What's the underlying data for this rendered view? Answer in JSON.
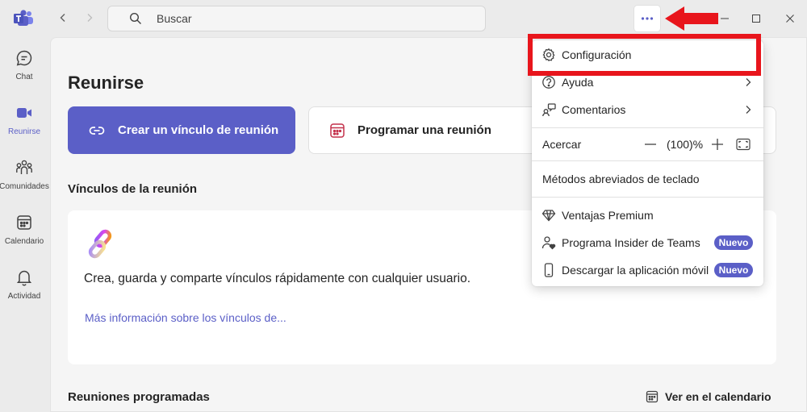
{
  "rail": {
    "items": [
      {
        "label": "Chat"
      },
      {
        "label": "Reunirse"
      },
      {
        "label": "Comunidades"
      },
      {
        "label": "Calendario"
      },
      {
        "label": "Actividad"
      }
    ]
  },
  "titlebar": {
    "search_placeholder": "Buscar"
  },
  "main": {
    "title": "Reunirse",
    "create_link_label": "Crear un vínculo de reunión",
    "schedule_label": "Programar una reunión",
    "links_section_title": "Vínculos de la reunión",
    "card_text": "Crea, guarda y comparte vínculos rápidamente con cualquier usuario.",
    "card_link": "Más información sobre los vínculos de...",
    "scheduled_title": "Reuniones programadas",
    "calendar_link": "Ver en el calendario"
  },
  "menu": {
    "settings": "Configuración",
    "help": "Ayuda",
    "feedback": "Comentarios",
    "zoom_label": "Acercar",
    "zoom_value": "(100)%",
    "shortcuts": "Métodos abreviados de teclado",
    "premium": "Ventajas Premium",
    "insider": "Programa Insider de Teams",
    "insider_badge": "Nuevo",
    "mobile": "Descargar la aplicación móvil",
    "mobile_badge": "Nuevo"
  },
  "colors": {
    "accent": "#5b5fc7",
    "annotation_red": "#e8151c"
  }
}
